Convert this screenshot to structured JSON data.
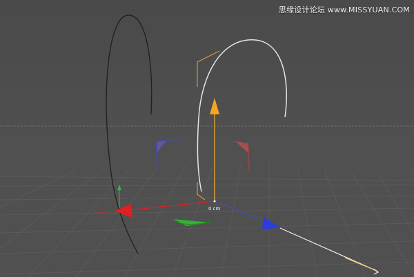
{
  "watermark": {
    "text": "思缘设计论坛 www.MISSYUAN.COM"
  },
  "viewport": {
    "distance_readout": "0 cm"
  },
  "colors": {
    "background": "#4b4b4b",
    "ground_plane": "#505050",
    "grid_line": "#5c5c5c",
    "horizon_dashed": "#7a7a7a",
    "spline_inactive": "#222222",
    "spline_active": "#e6e6e6",
    "axis_x": "#e02020",
    "axis_y": "#f5a623",
    "axis_z": "#2b3ce0",
    "axis_green": "#2fbf2f",
    "handle_orange": "#e8922a",
    "plane_blue": "#5a5ab4",
    "plane_red": "#b45050"
  },
  "icons": {
    "move_arrow_y": "cone-arrow-icon",
    "move_arrow_x": "cone-arrow-icon",
    "move_arrow_z": "cone-arrow-icon"
  }
}
